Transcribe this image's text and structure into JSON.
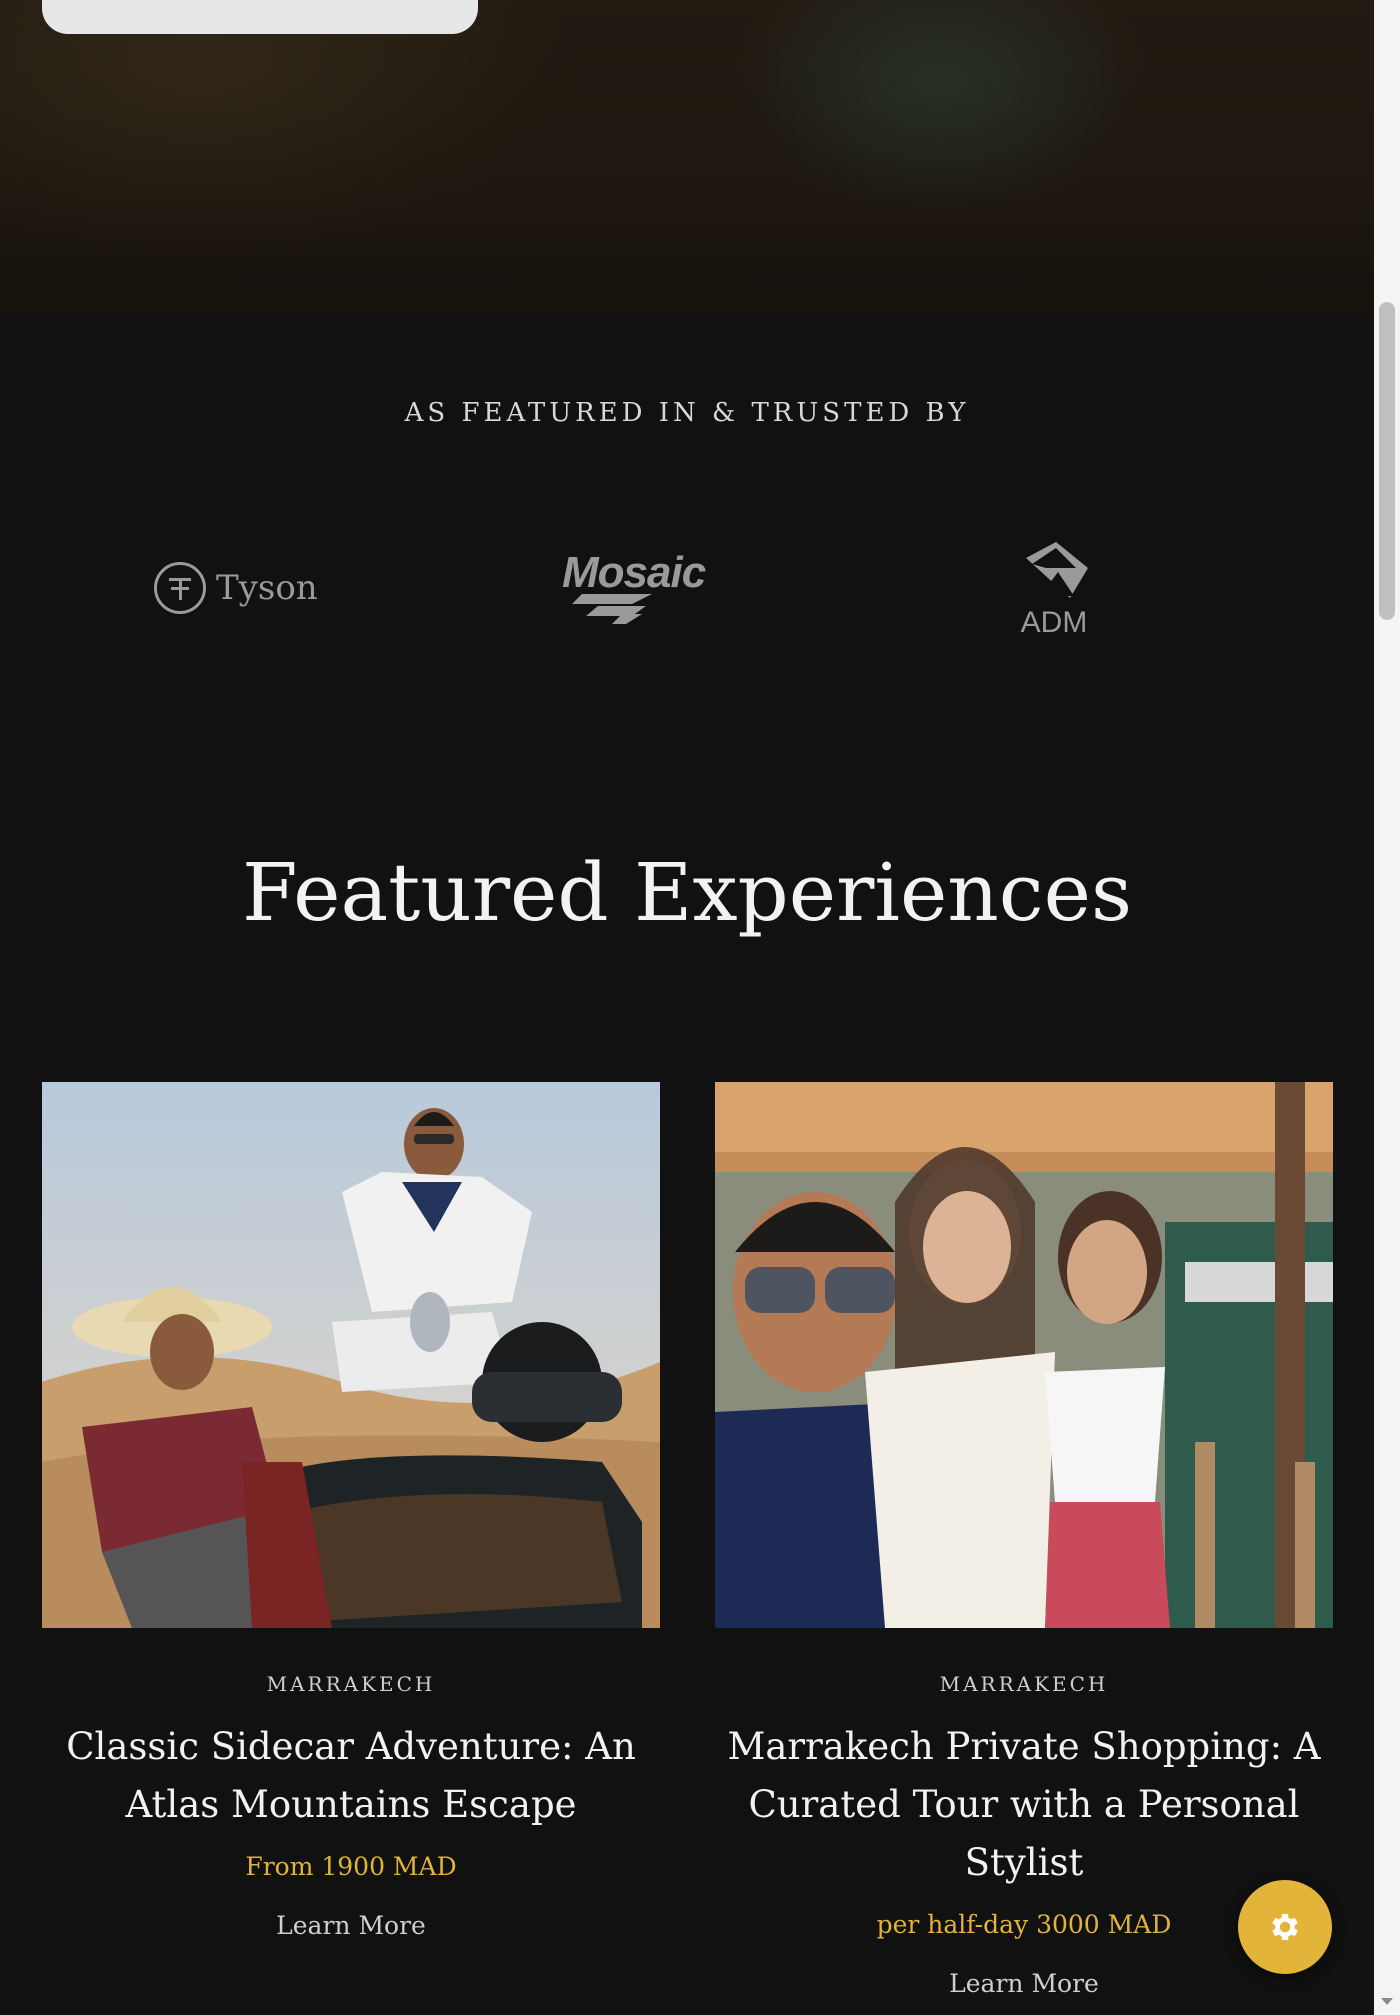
{
  "featured_in": {
    "heading": "AS FEATURED IN & TRUSTED BY",
    "logos": [
      {
        "name": "Tyson",
        "icon": "tyson-logo"
      },
      {
        "name": "Mosaic",
        "icon": "mosaic-logo"
      },
      {
        "name": "ADM",
        "icon": "adm-logo"
      }
    ]
  },
  "section": {
    "title": "Featured Experiences"
  },
  "cards": [
    {
      "location": "MARRAKECH",
      "title": "Classic Sidecar Adventure: An Atlas Mountains Escape",
      "price": "From 1900 MAD",
      "link": "Learn More"
    },
    {
      "location": "MARRAKECH",
      "title": "Marrakech Private Shopping: A Curated Tour with a Personal Stylist",
      "price": "per half-day 3000 MAD",
      "link": "Learn More"
    }
  ],
  "colors": {
    "background": "#111111",
    "accent": "#e0b33a",
    "fab": "#e2b53a"
  },
  "fab": {
    "icon": "gear-icon"
  }
}
